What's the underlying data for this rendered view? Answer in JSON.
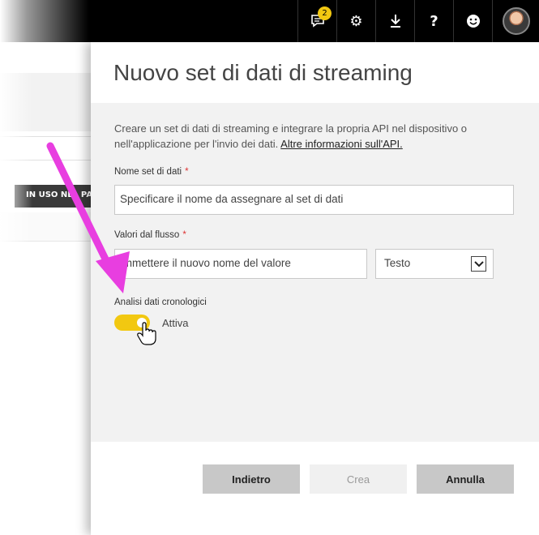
{
  "topbar": {
    "notifications_count": "2",
    "icons": [
      "notifications-icon",
      "gear-icon",
      "download-icon",
      "help-icon",
      "feedback-smiley-icon",
      "avatar"
    ]
  },
  "background": {
    "tab_label": "IN USO NEL PAS"
  },
  "panel": {
    "title": "Nuovo set di dati di streaming",
    "description": "Creare un set di dati di streaming e integrare la propria API nel dispositivo o nell'applicazione per l'invio dei dati.",
    "link": "Altre informazioni sull'API.",
    "dataset_name": {
      "label": "Nome set di dati",
      "required": "*",
      "placeholder": "Specificare il nome da assegnare al set di dati"
    },
    "stream_values": {
      "label": "Valori dal flusso",
      "required": "*",
      "placeholder": "Immettere il nuovo nome del valore",
      "type_selected": "Testo"
    },
    "history": {
      "label": "Analisi dati cronologici",
      "toggle_state": "Attiva",
      "toggle_on": true
    },
    "buttons": {
      "back": "Indietro",
      "create": "Crea",
      "cancel": "Annulla"
    }
  },
  "colors": {
    "accent": "#f2c811",
    "arrow": "#e83ee0",
    "topbar": "#000000",
    "body": "#f2f2f2"
  }
}
